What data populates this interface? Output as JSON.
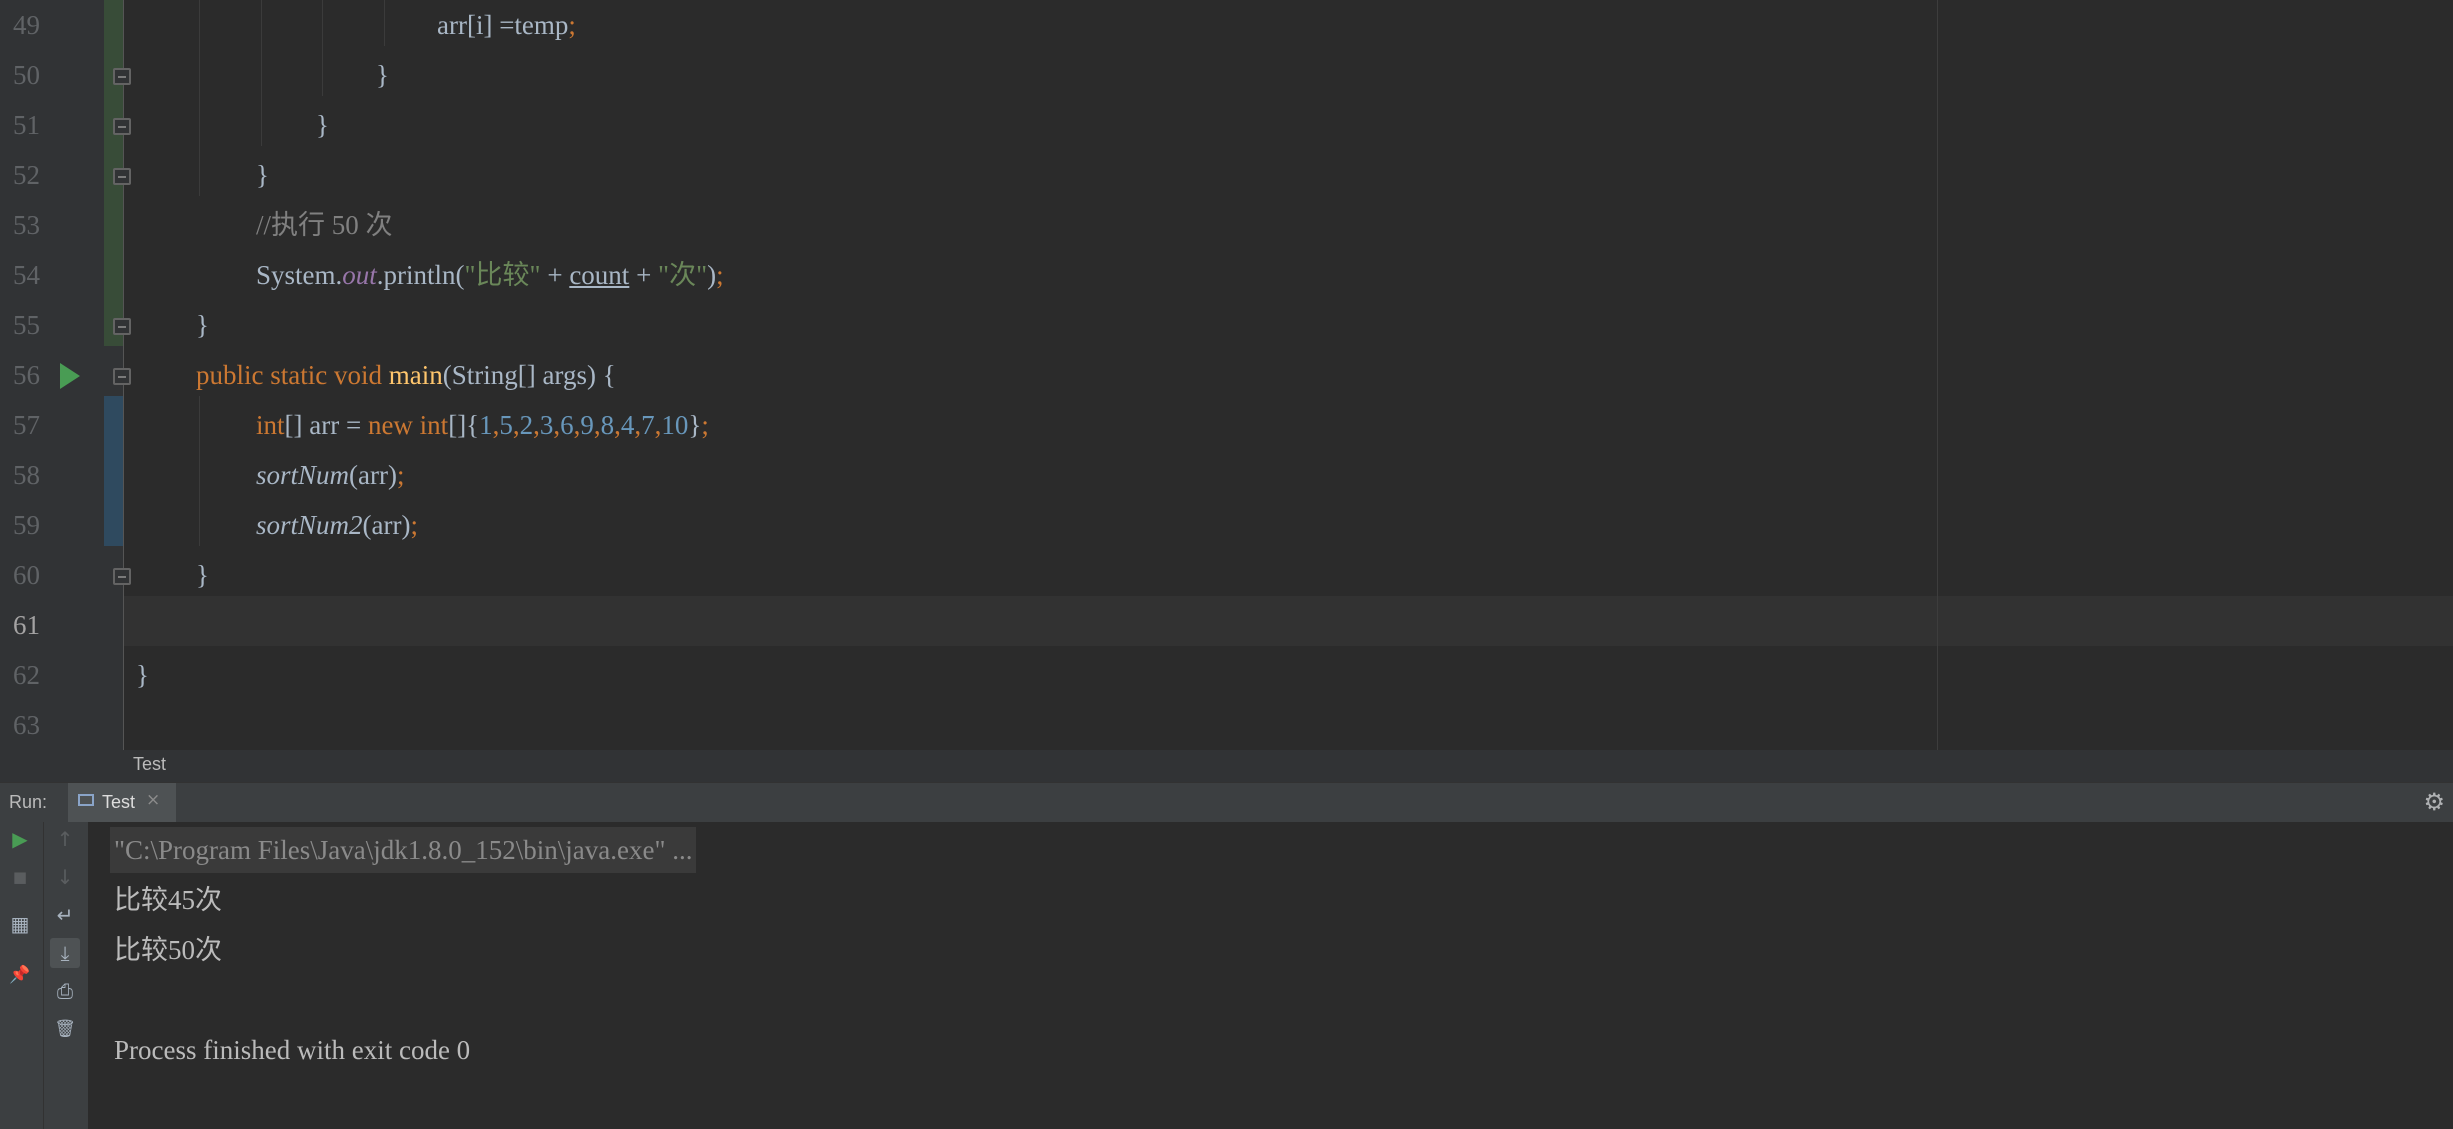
{
  "editor": {
    "line_numbers": [
      "49",
      "50",
      "51",
      "52",
      "53",
      "54",
      "55",
      "56",
      "57",
      "58",
      "59",
      "60",
      "61",
      "62",
      "63"
    ],
    "current_line": "61",
    "code": {
      "l49_a": "arr[i] =temp",
      "l49_b": ";",
      "l50": "}",
      "l51": "}",
      "l52": "}",
      "l53": "//执行 50 次",
      "l54_system": "System.",
      "l54_out": "out",
      "l54_println": ".println(",
      "l54_str1": "\"比较\"",
      "l54_plus1": " + ",
      "l54_count": "count",
      "l54_plus2": " + ",
      "l54_str2": "\"次\"",
      "l54_close": ")",
      "l54_semi": ";",
      "l55": "}",
      "l56_mods": "public static void ",
      "l56_name": "main",
      "l56_params": "(String[] args) {",
      "l57_int": "int",
      "l57_decl": "[] arr = ",
      "l57_new": "new int",
      "l57_brk": "[]{",
      "l57_values": [
        "1",
        "5",
        "2",
        "3",
        "6",
        "9",
        "8",
        "4",
        "7",
        "10"
      ],
      "l57_comma": ",",
      "l57_close": "}",
      "l57_semi": ";",
      "l58_call": "sortNum",
      "l58_args": "(arr)",
      "l58_semi": ";",
      "l59_call": "sortNum2",
      "l59_args": "(arr)",
      "l59_semi": ";",
      "l60": "}",
      "l62": "}"
    }
  },
  "breadcrumb": "Test",
  "run_panel": {
    "label": "Run:",
    "tab_label": "Test",
    "tab_close": "×",
    "settings_icon": "gear-icon",
    "output": [
      "\"C:\\Program Files\\Java\\jdk1.8.0_152\\bin\\java.exe\" ...",
      "比较45次",
      "比较50次",
      "",
      "Process finished with exit code 0"
    ]
  },
  "toolbar": {
    "rerun": "▶",
    "stop": "■",
    "up": "↑",
    "down": "↓",
    "layout": "▦",
    "soft_wrap": "↵",
    "scroll_end": "⤓",
    "pin": "📌",
    "print": "⎙",
    "clear": "🗑"
  },
  "colors": {
    "editor_bg": "#2b2b2b",
    "gutter_bg": "#313335",
    "keyword": "#cc7832",
    "function": "#ffc66d",
    "number": "#6897bb",
    "string": "#6a8759",
    "comment": "#808080",
    "static_field": "#9876aa",
    "run_green": "#499c54"
  }
}
